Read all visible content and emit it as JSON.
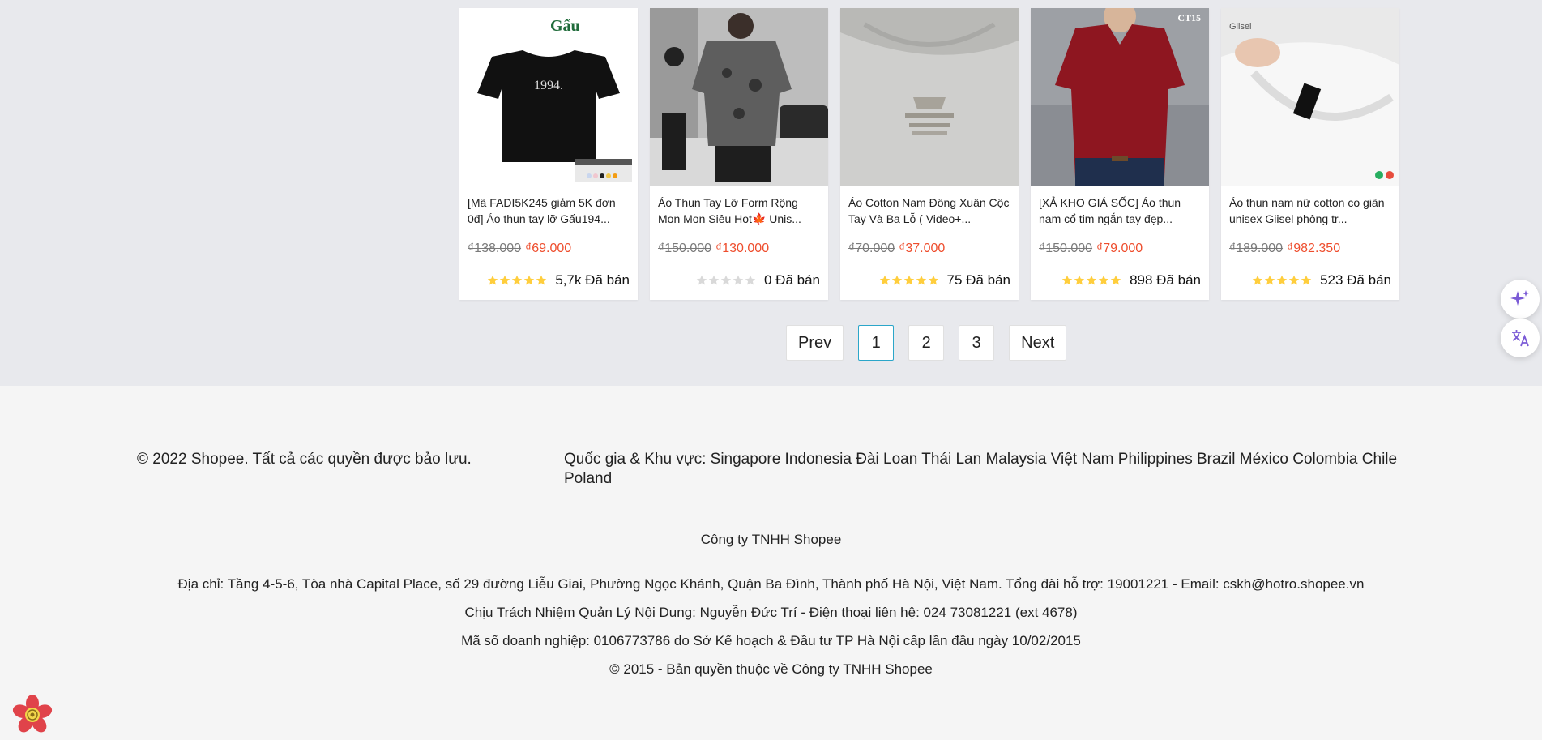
{
  "products": [
    {
      "title": "[Mã FADI5K245 giảm 5K đơn 0đ] Áo thun tay lỡ Gấu194...",
      "old_price": "₫138.000",
      "price": "₫69.000",
      "sold": "5,7k Đã bán",
      "rating": 5,
      "brand_mark": "Gấu",
      "print_text": "1994."
    },
    {
      "title": "Áo Thun Tay Lỡ Form Rộng Mon Mon Siêu Hot🍁 Unis...",
      "old_price": "₫150.000",
      "price": "₫130.000",
      "sold": "0 Đã bán",
      "rating": 0
    },
    {
      "title": "Áo Cotton Nam Đông Xuân Cộc Tay Và Ba Lỗ ( Video+...",
      "old_price": "₫70.000",
      "price": "₫37.000",
      "sold": "75 Đã bán",
      "rating": 5
    },
    {
      "title": "[XẢ KHO GIÁ SỐC] Áo thun nam cổ tim ngắn tay đẹp...",
      "old_price": "₫150.000",
      "price": "₫79.000",
      "sold": "898 Đã bán",
      "rating": 5,
      "corner_tag": "CT15"
    },
    {
      "title": "Áo thun nam nữ cotton co giãn unisex Giisel phông tr...",
      "old_price": "₫189.000",
      "price": "₫982.350",
      "sold": "523 Đã bán",
      "rating": 5,
      "brand_mark": "Giisel"
    }
  ],
  "pagination": {
    "prev": "Prev",
    "pages": [
      "1",
      "2",
      "3"
    ],
    "active_page": "1",
    "next": "Next"
  },
  "footer": {
    "copyright": "© 2022 Shopee. Tất cả các quyền được bảo lưu.",
    "countries_label": "Quốc gia & Khu vực:",
    "countries": [
      "Singapore",
      "Indonesia",
      "Đài Loan",
      "Thái Lan",
      "Malaysia",
      "Việt Nam",
      "Philippines",
      "Brazil",
      "México",
      "Colombia",
      "Chile",
      "Poland"
    ],
    "company": "Công ty TNHH Shopee",
    "address": "Địa chỉ: Tầng 4-5-6, Tòa nhà Capital Place, số 29 đường Liễu Giai, Phường Ngọc Khánh, Quận Ba Đình, Thành phố Hà Nội, Việt Nam. Tổng đài hỗ trợ: 19001221 - Email: cskh@hotro.shopee.vn",
    "responsible": "Chịu Trách Nhiệm Quản Lý Nội Dung: Nguyễn Đức Trí - Điện thoại liên hệ: 024 73081221 (ext 4678)",
    "business_code": "Mã số doanh nghiệp: 0106773786 do Sở Kế hoạch & Đầu tư TP Hà Nội cấp lần đầu ngày 10/02/2015",
    "copyright_2015": "© 2015 - Bản quyền thuộc về Công ty TNHH Shopee"
  },
  "icons": {
    "side_ai": "sparkle-icon",
    "side_translate": "translate-icon",
    "bottom_logo": "flower-logo-icon"
  },
  "colors": {
    "price": "#ee4d2d",
    "star": "#ffce3d",
    "active_page_border": "#2ba6c9",
    "accent_purple": "#7b5bd6"
  }
}
